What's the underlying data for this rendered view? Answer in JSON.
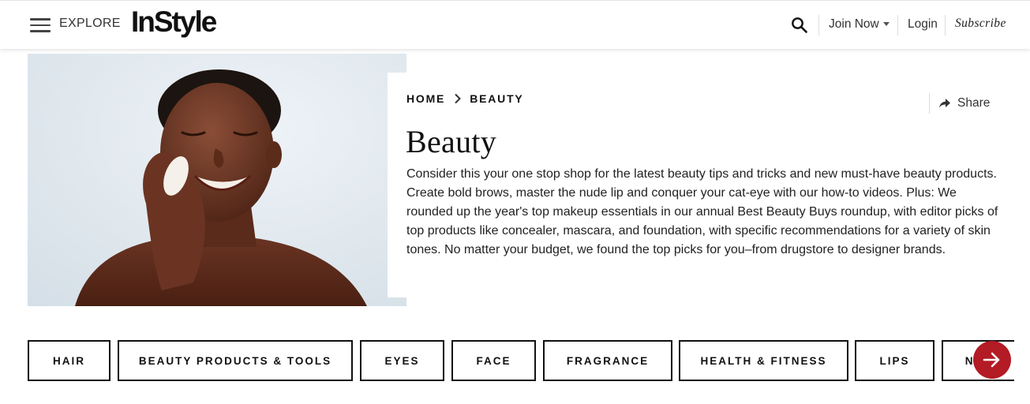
{
  "header": {
    "explore_label": "EXPLORE",
    "logo_text": "InStyle",
    "join_label": "Join Now",
    "login_label": "Login",
    "subscribe_label": "Subscribe"
  },
  "breadcrumb": {
    "home": "HOME",
    "current": "BEAUTY"
  },
  "share_label": "Share",
  "page_title": "Beauty",
  "description": "Consider this your one stop shop for the latest beauty tips and tricks and new must-have beauty products. Create bold brows, master the nude lip and conquer your cat-eye with our how-to videos. Plus: We rounded up the year's top makeup essentials in our annual Best Beauty Buys roundup, with editor picks of top products like concealer, mascara, and foundation, with specific recommendations for a variety of skin tones. No matter your budget, we found the top picks for you–from drugstore to designer brands.",
  "tabs": [
    {
      "label": "HAIR"
    },
    {
      "label": "BEAUTY PRODUCTS & TOOLS"
    },
    {
      "label": "EYES"
    },
    {
      "label": "FACE"
    },
    {
      "label": "FRAGRANCE"
    },
    {
      "label": "HEALTH & FITNESS"
    },
    {
      "label": "LIPS"
    },
    {
      "label": "NAILS"
    }
  ],
  "colors": {
    "accent": "#b31b25",
    "text": "#111111"
  }
}
